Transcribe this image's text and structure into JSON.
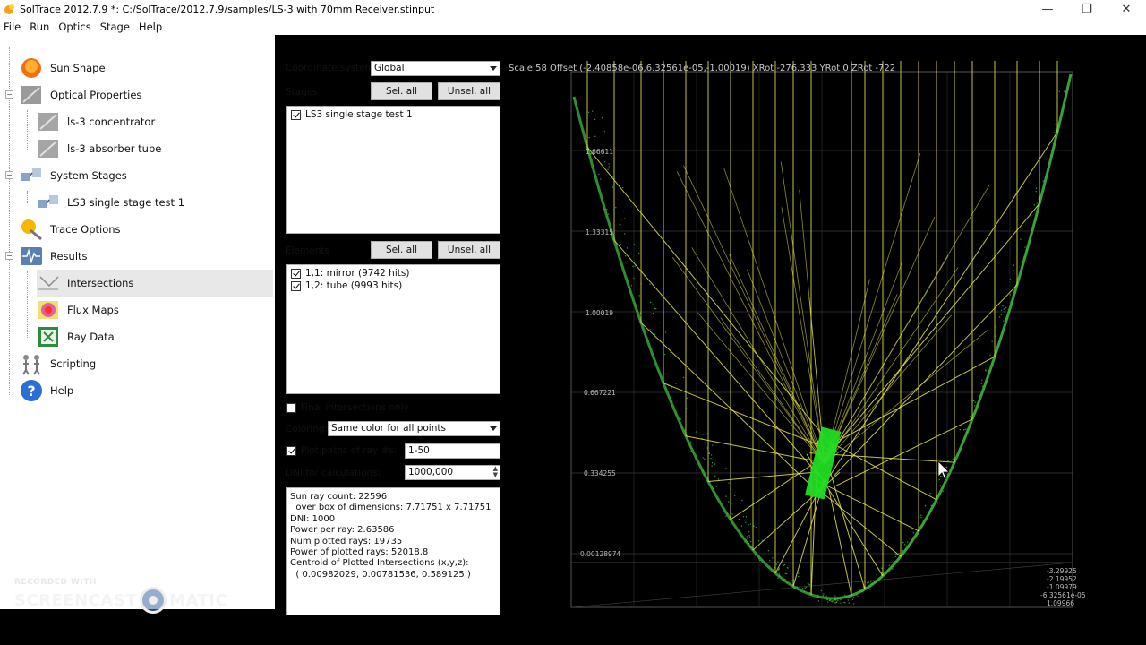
{
  "window": {
    "title": "SolTrace 2012.7.9 *: C:/SolTrace/2012.7.9/samples/LS-3 with 70mm Receiver.stinput",
    "minimize": "—",
    "restore": "❐",
    "close": "✕"
  },
  "menu": [
    "File",
    "Run",
    "Optics",
    "Stage",
    "Help"
  ],
  "tree": {
    "sun_shape": "Sun Shape",
    "optical_properties": "Optical Properties",
    "concentrator": "ls-3 concentrator",
    "absorber": "ls-3 absorber tube",
    "system_stages": "System Stages",
    "stage1": "LS3 single stage test 1",
    "trace_options": "Trace Options",
    "results": "Results",
    "intersections": "Intersections",
    "flux_maps": "Flux Maps",
    "ray_data": "Ray Data",
    "scripting": "Scripting",
    "help": "Help"
  },
  "panel": {
    "coord_label": "Coordinate system:",
    "coord_value": "Global",
    "stages_label": "Stages",
    "sel_all": "Sel. all",
    "unsel_all": "Unsel. all",
    "stages": [
      "LS3 single stage test 1"
    ],
    "elements_label": "Elements",
    "elements": [
      "1,1: mirror (9742 hits)",
      "1,2: tube (9993 hits)"
    ],
    "final_only": "Final intersections only",
    "coloring_label": "Coloring:",
    "coloring_value": "Same color for all points",
    "plot_paths_label": "Plot paths of ray #s:",
    "plot_paths_value": "1-50",
    "dni_label": "DNI for calculations:",
    "dni_value": "1000,000"
  },
  "stats": [
    "Sun ray count: 22596",
    "  over box of dimensions: 7.71751 x 7.71751",
    "DNI: 1000",
    "Power per ray: 2.63586",
    "Num plotted rays: 19735",
    "Power of plotted rays: 52018.8",
    "Centroid of Plotted Intersections (x,y,z):",
    "  ( 0.00982029, 0.00781536, 0.589125 )"
  ],
  "plot": {
    "header": "Scale 58 Offset (-2.40858e-06,6.32561e-05,-1.00019) XRot -276.333 YRot 0 ZRot -722",
    "z_ticks": [
      "1.66611",
      "1.33315",
      "1.00019",
      "0.667221",
      "0.334255",
      "0.00128974"
    ],
    "corner_ticks": [
      "-3.29925",
      "-2.19952",
      "-1.09979",
      "-6.32561e-05",
      "1.09966"
    ],
    "colors": {
      "rays": "#e6e64a",
      "hits": "#3fbf3f",
      "tube": "#22dd22",
      "grid": "#555555"
    }
  },
  "watermark": {
    "top": "RECORDED WITH",
    "left": "SCREENCAST",
    "right": "MATIC"
  }
}
